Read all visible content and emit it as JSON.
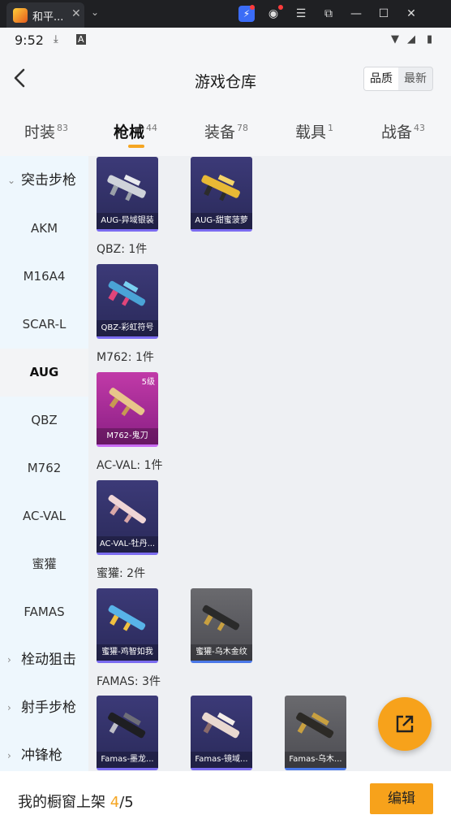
{
  "window": {
    "tab_title": "和平..."
  },
  "status": {
    "time": "9:52"
  },
  "header": {
    "title": "游戏仓库",
    "sort_options": [
      "品质",
      "最新"
    ],
    "sort_active": "品质"
  },
  "category_tabs": [
    {
      "label": "时装",
      "count": "83"
    },
    {
      "label": "枪械",
      "count": "44"
    },
    {
      "label": "装备",
      "count": "78"
    },
    {
      "label": "载具",
      "count": "1"
    },
    {
      "label": "战备",
      "count": "43"
    }
  ],
  "sidebar": {
    "items": [
      {
        "label": "突击步枪",
        "type": "group"
      },
      {
        "label": "AKM",
        "type": "item"
      },
      {
        "label": "M16A4",
        "type": "item"
      },
      {
        "label": "SCAR-L",
        "type": "item"
      },
      {
        "label": "AUG",
        "type": "item",
        "active": true
      },
      {
        "label": "QBZ",
        "type": "item"
      },
      {
        "label": "M762",
        "type": "item"
      },
      {
        "label": "AC-VAL",
        "type": "item"
      },
      {
        "label": "蜜獾",
        "type": "item"
      },
      {
        "label": "FAMAS",
        "type": "item"
      },
      {
        "label": "栓动狙击",
        "type": "group"
      },
      {
        "label": "射手步枪",
        "type": "group"
      },
      {
        "label": "冲锋枪",
        "type": "group"
      }
    ]
  },
  "sections": [
    {
      "title": "",
      "cards": [
        {
          "name": "AUG-异域银装",
          "rarity": "purple"
        },
        {
          "name": "AUG-甜蜜菠萝",
          "rarity": "purple"
        }
      ]
    },
    {
      "title": "QBZ: 1件",
      "cards": [
        {
          "name": "QBZ-彩虹符号",
          "rarity": "purple"
        }
      ]
    },
    {
      "title": "M762: 1件",
      "cards": [
        {
          "name": "M762-鬼刀",
          "rarity": "pink",
          "level": "5级"
        }
      ]
    },
    {
      "title": "AC-VAL: 1件",
      "cards": [
        {
          "name": "AC-VAL-牡丹...",
          "rarity": "purple"
        }
      ]
    },
    {
      "title": "蜜獾: 2件",
      "cards": [
        {
          "name": "蜜獾-鸡智如我",
          "rarity": "purple"
        },
        {
          "name": "蜜獾-乌木金纹",
          "rarity": "gray"
        }
      ]
    },
    {
      "title": "FAMAS: 3件",
      "cards": [
        {
          "name": "Famas-墨龙...",
          "rarity": "purple"
        },
        {
          "name": "Famas-镜域...",
          "rarity": "purple"
        },
        {
          "name": "Famas-乌木...",
          "rarity": "gray"
        }
      ]
    }
  ],
  "bottom": {
    "shelf_label": "我的橱窗上架",
    "shelf_count": "4",
    "shelf_total": "/5",
    "edit_label": "编辑"
  },
  "colors": {
    "accent": "#f7a21b",
    "purple_card": "#3c3a78",
    "pink_card": "#c13aa8",
    "gray_card": "#5a5a60"
  }
}
